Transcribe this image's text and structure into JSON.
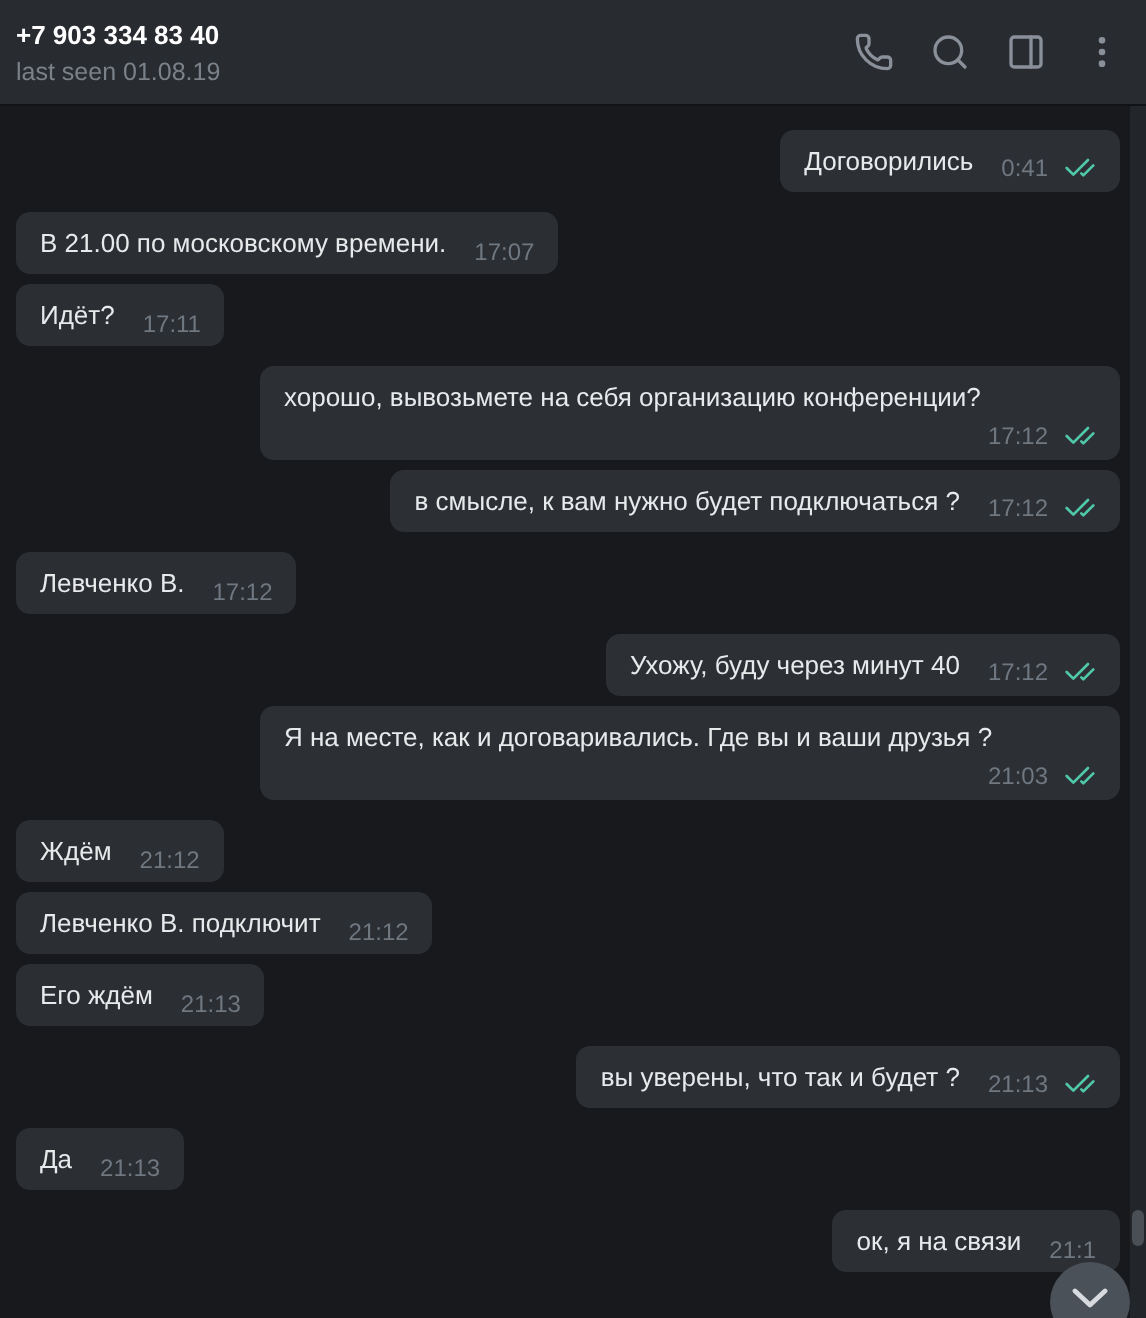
{
  "header": {
    "title": "+7 903 334 83 40",
    "status": "last seen 01.08.19"
  },
  "messages": [
    {
      "kind": "outgoing",
      "text": "Договорились",
      "time": "0:41",
      "read": true
    },
    {
      "kind": "incoming",
      "text": "В 21.00 по московскому времени.",
      "time": "17:07"
    },
    {
      "kind": "incoming",
      "text": "Идёт?",
      "time": "17:11"
    },
    {
      "kind": "outgoing",
      "text": "хорошо, вывозьмете на себя организацию конференции?",
      "time": "17:12",
      "read": true
    },
    {
      "kind": "outgoing",
      "text": "в смысле, к вам нужно будет подключаться ?",
      "time": "17:12",
      "read": true
    },
    {
      "kind": "incoming",
      "text": "Левченко В.",
      "time": "17:12"
    },
    {
      "kind": "outgoing",
      "text": "Ухожу, буду через минут 40",
      "time": "17:12",
      "read": true
    },
    {
      "kind": "outgoing",
      "text": "Я на месте, как и договаривались. Где вы и ваши друзья ?",
      "time": "21:03",
      "read": true
    },
    {
      "kind": "incoming",
      "text": "Ждём",
      "time": "21:12"
    },
    {
      "kind": "incoming",
      "text": "Левченко В. подключит",
      "time": "21:12"
    },
    {
      "kind": "incoming",
      "text": "Его ждём",
      "time": "21:13"
    },
    {
      "kind": "outgoing",
      "text": "вы уверены, что так и будет ?",
      "time": "21:13",
      "read": true
    },
    {
      "kind": "incoming",
      "text": "Да",
      "time": "21:13"
    },
    {
      "kind": "outgoing",
      "text": "ок, я на связи",
      "time": "21:1",
      "read": false
    }
  ]
}
